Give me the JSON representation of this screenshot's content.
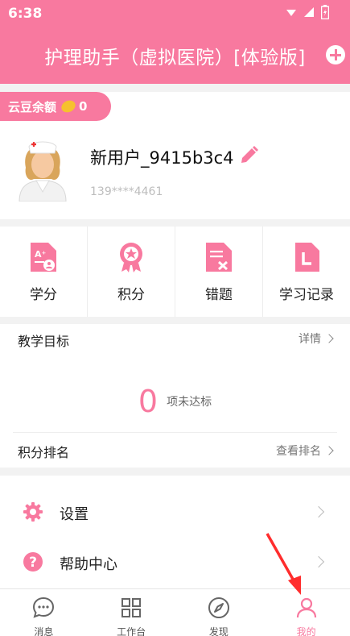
{
  "status_bar": {
    "time": "6:38"
  },
  "header": {
    "title": "护理助手（虚拟医院）[体验版]",
    "add_icon": "plus-circle-icon"
  },
  "balance": {
    "label": "云豆余额",
    "value": "0"
  },
  "user": {
    "name": "新用户_9415b3c4",
    "phone": "139****4461"
  },
  "quick_actions": [
    {
      "label": "学分",
      "icon": "credit-icon"
    },
    {
      "label": "积分",
      "icon": "medal-icon"
    },
    {
      "label": "错题",
      "icon": "wrong-answer-icon"
    },
    {
      "label": "学习记录",
      "icon": "study-record-icon"
    }
  ],
  "goals": {
    "title": "教学目标",
    "link": "详情",
    "count": "0",
    "count_label": "项未达标"
  },
  "ranking": {
    "title": "积分排名",
    "link": "查看排名"
  },
  "menu": [
    {
      "label": "设置",
      "icon": "gear-icon"
    },
    {
      "label": "帮助中心",
      "icon": "help-icon"
    }
  ],
  "tabs": [
    {
      "label": "消息",
      "icon": "chat-icon"
    },
    {
      "label": "工作台",
      "icon": "grid-icon"
    },
    {
      "label": "发现",
      "icon": "compass-icon"
    },
    {
      "label": "我的",
      "icon": "person-icon",
      "active": true
    }
  ],
  "colors": {
    "accent": "#f8799f",
    "annotation_arrow": "#ff2d2d"
  }
}
